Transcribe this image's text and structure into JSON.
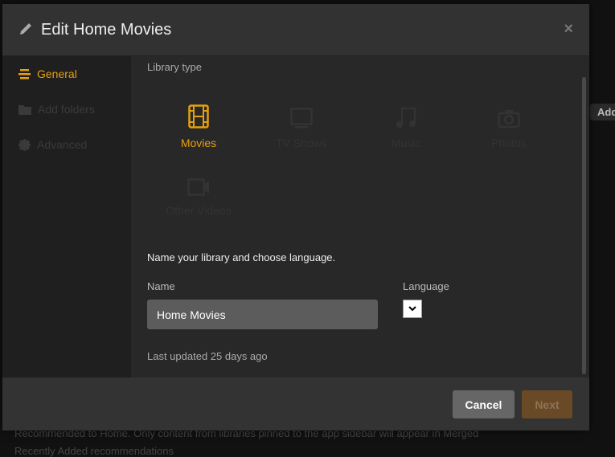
{
  "background": {
    "text_line1": "Recommended to Home. Only content from libraries pinned to the app sidebar will appear in Merged",
    "text_line2": "Recently Added recommendations",
    "side_tab": "Add"
  },
  "dialog": {
    "title": "Edit Home Movies",
    "close_label": "×",
    "sidebar": [
      {
        "label": "General",
        "icon": "list-icon",
        "active": true
      },
      {
        "label": "Add folders",
        "icon": "folder-icon",
        "active": false
      },
      {
        "label": "Advanced",
        "icon": "gear-icon",
        "active": false
      }
    ],
    "library_type_label": "Library type",
    "library_types": [
      {
        "label": "Movies",
        "icon": "film-icon",
        "active": true
      },
      {
        "label": "TV Shows",
        "icon": "tv-icon",
        "active": false
      },
      {
        "label": "Music",
        "icon": "music-icon",
        "active": false
      },
      {
        "label": "Photos",
        "icon": "camera-icon",
        "active": false
      },
      {
        "label": "Other Videos",
        "icon": "video-camera-icon",
        "active": false
      }
    ],
    "section_heading": "Name your library and choose language.",
    "name_label": "Name",
    "name_value": "Home Movies",
    "language_label": "Language",
    "language_value": "",
    "last_updated": "Last updated 25 days ago",
    "cancel_label": "Cancel",
    "next_label": "Next"
  },
  "colors": {
    "accent": "#e5a00d",
    "next_button": "#6a4a26"
  }
}
